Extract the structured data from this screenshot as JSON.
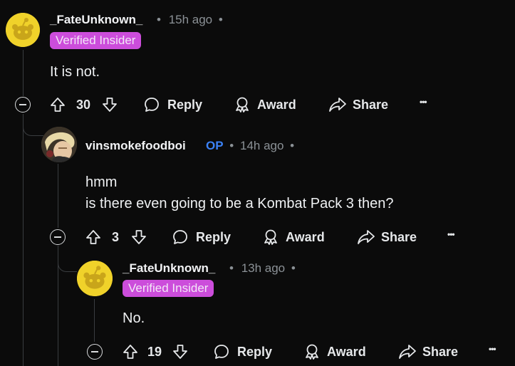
{
  "comments": [
    {
      "username": "_FateUnknown_",
      "time": "15h ago",
      "flair": "Verified Insider",
      "body": [
        "It is not."
      ],
      "votes": "30",
      "reply_label": "Reply",
      "award_label": "Award",
      "share_label": "Share",
      "more_label": "•••"
    },
    {
      "username": "vinsmokefoodboi",
      "op_label": "OP",
      "time": "14h ago",
      "body": [
        "hmm",
        "is there even going to be a Kombat Pack 3 then?"
      ],
      "votes": "3",
      "reply_label": "Reply",
      "award_label": "Award",
      "share_label": "Share",
      "more_label": "•••"
    },
    {
      "username": "_FateUnknown_",
      "time": "13h ago",
      "flair": "Verified Insider",
      "body": [
        "No."
      ],
      "votes": "19",
      "reply_label": "Reply",
      "award_label": "Award",
      "share_label": "Share",
      "more_label": "•••"
    }
  ],
  "separator": "•"
}
